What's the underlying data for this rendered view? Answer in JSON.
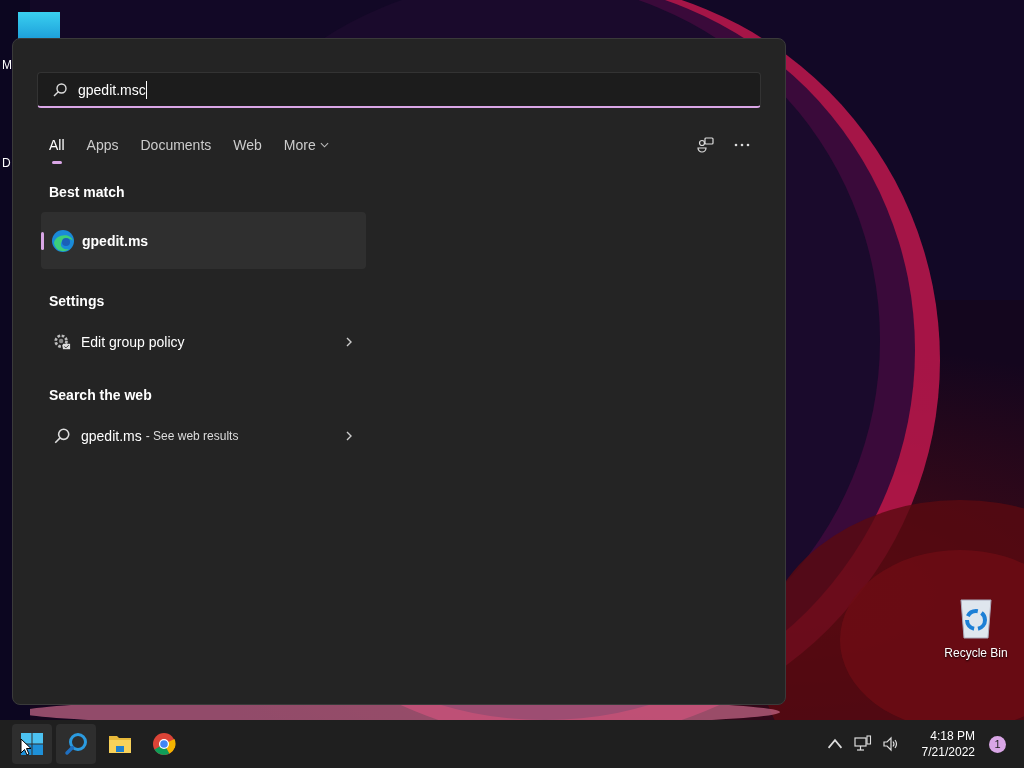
{
  "desktop": {
    "icons": [
      {
        "label": "M"
      },
      {
        "label": "D"
      }
    ],
    "recycle_bin": {
      "label": "Recycle Bin"
    }
  },
  "search_panel": {
    "query": "gpedit.msc",
    "tabs": [
      {
        "label": "All",
        "selected": true,
        "kind": "tab"
      },
      {
        "label": "Apps",
        "selected": false,
        "kind": "tab"
      },
      {
        "label": "Documents",
        "selected": false,
        "kind": "tab"
      },
      {
        "label": "Web",
        "selected": false,
        "kind": "tab"
      },
      {
        "label": "More",
        "selected": false,
        "kind": "dropdown"
      }
    ],
    "sections": [
      {
        "title": "Best match",
        "items": [
          {
            "kind": "app",
            "label": "gpedit.ms",
            "selected": true
          }
        ]
      },
      {
        "title": "Settings",
        "items": [
          {
            "kind": "setting",
            "label": "Edit group policy",
            "selected": false
          }
        ]
      },
      {
        "title": "Search the web",
        "items": [
          {
            "kind": "web",
            "label": "gpedit.ms",
            "suffix": "- See web results",
            "selected": false
          }
        ]
      }
    ]
  },
  "taskbar": {
    "apps": [
      {
        "kind": "start",
        "selected": true
      },
      {
        "kind": "search",
        "selected": true
      },
      {
        "kind": "explorer",
        "selected": false
      },
      {
        "kind": "chrome",
        "selected": false
      }
    ],
    "clock": {
      "time": "4:18 PM",
      "date": "7/21/2022"
    },
    "notification_count": "1"
  }
}
